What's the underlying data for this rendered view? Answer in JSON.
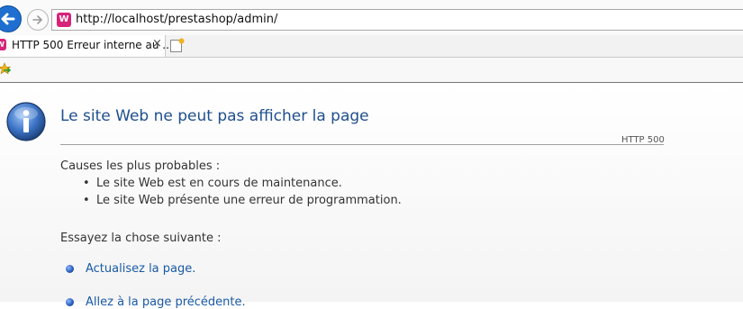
{
  "browser": {
    "address": "http://localhost/prestashop/admin/",
    "tab_title": "HTTP 500 Erreur interne au ...",
    "tab_close": "×",
    "site_icon_letter": "W"
  },
  "error_page": {
    "heading": "Le site Web ne peut pas afficher la page",
    "http_code": "HTTP 500",
    "causes_title": "Causes les plus probables :",
    "causes": [
      "Le site Web est en cours de maintenance.",
      "Le site Web présente une erreur de programmation."
    ],
    "try_title": "Essayez la chose suivante :",
    "actions": [
      "Actualisez la page.",
      "Allez à la page précédente."
    ]
  },
  "colors": {
    "heading": "#1f4f8f",
    "link": "#1a5aa6",
    "back_button": "#1e6fd0",
    "site_icon": "#d7237a"
  },
  "icons": {
    "back": "back-arrow-icon",
    "forward": "forward-arrow-icon",
    "site": "wamp-site-icon",
    "new_tab": "new-tab-icon",
    "favorites": "favorites-icon",
    "info": "info-icon",
    "action_bullet": "bullet-icon"
  }
}
